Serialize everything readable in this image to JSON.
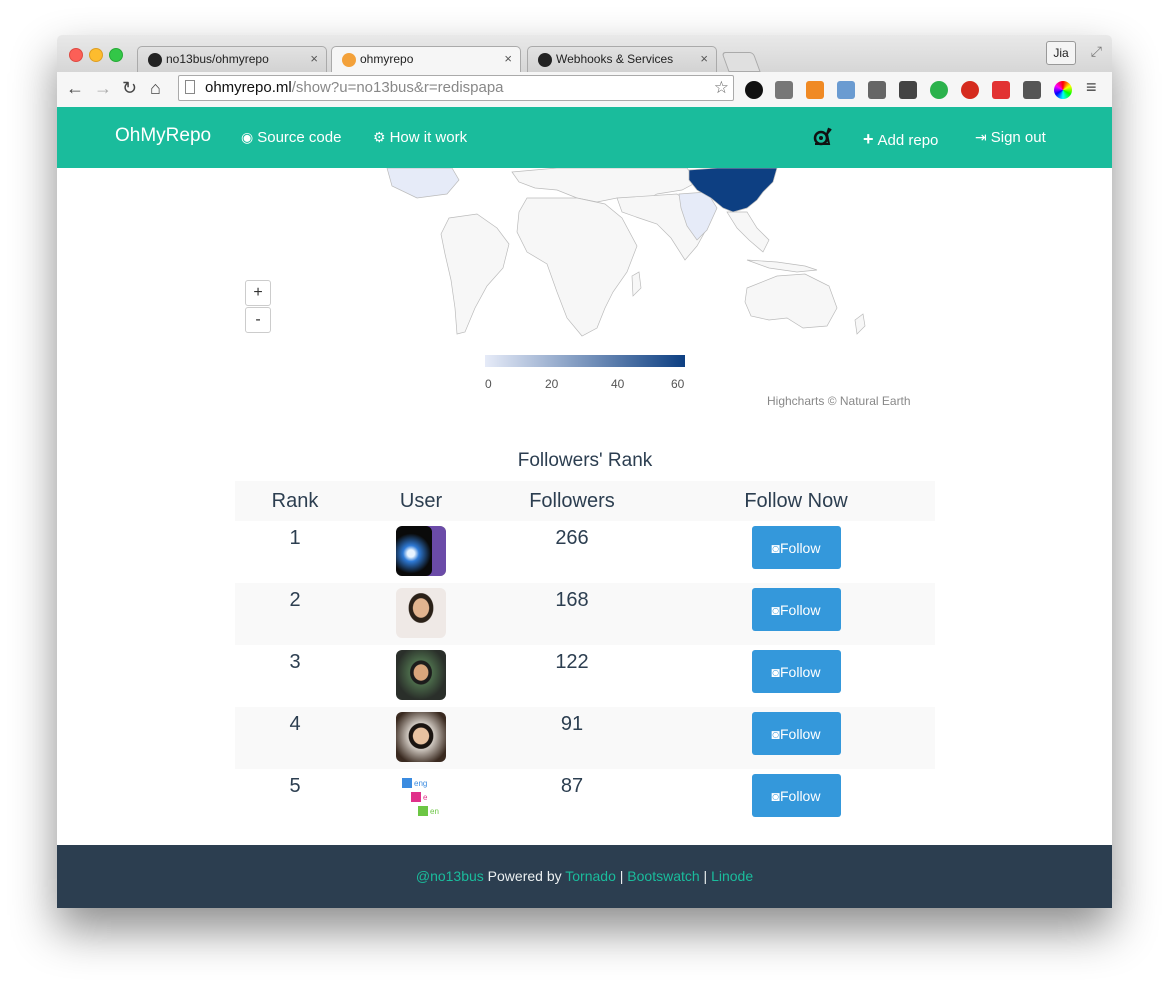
{
  "browser": {
    "tabs": [
      {
        "title": "no13bus/ohmyrepo",
        "close": "×"
      },
      {
        "title": "ohmyrepo",
        "close": "×"
      },
      {
        "title": "Webhooks & Services",
        "close": "×"
      }
    ],
    "profile_name": "Jia",
    "url_host": "ohmyrepo.ml",
    "url_path": "/show?u=no13bus&r=redispapa",
    "extensions": [
      "record-icon",
      "pocket-icon",
      "dict-icon",
      "bookmark-star-icon",
      "scissors-icon",
      "evernote-icon",
      "pushbullet-icon",
      "adblock-plus-icon",
      "health-icon",
      "screenshot-icon",
      "color-wheel-icon",
      "menu-icon"
    ]
  },
  "navbar": {
    "brand": "OhMyRepo",
    "source_code": "Source code",
    "how_it_work": "How it work",
    "add_repo": "Add repo",
    "sign_out": "Sign out"
  },
  "map": {
    "zoom_in": "+",
    "zoom_out": "-",
    "legend_ticks": [
      "0",
      "20",
      "40",
      "60"
    ],
    "credits": "Highcharts © Natural Earth",
    "colors": {
      "low": "#e6ebf8",
      "high": "#0d3f82"
    }
  },
  "rank": {
    "title": "Followers' Rank",
    "headers": [
      "Rank",
      "User",
      "Followers",
      "Follow Now"
    ],
    "follow_label": "Follow",
    "rows": [
      {
        "rank": "1",
        "followers": "266"
      },
      {
        "rank": "2",
        "followers": "168"
      },
      {
        "rank": "3",
        "followers": "122"
      },
      {
        "rank": "4",
        "followers": "91"
      },
      {
        "rank": "5",
        "followers": "87"
      }
    ]
  },
  "footer": {
    "user": "@no13bus",
    "powered": " Powered by ",
    "tornado": "Tornado",
    "sep1": " | ",
    "bootswatch": "Bootswatch",
    "sep2": " | ",
    "linode": "Linode"
  },
  "colors": {
    "accent": "#1abc9c",
    "button": "#3498db",
    "footer": "#2c3e50"
  }
}
